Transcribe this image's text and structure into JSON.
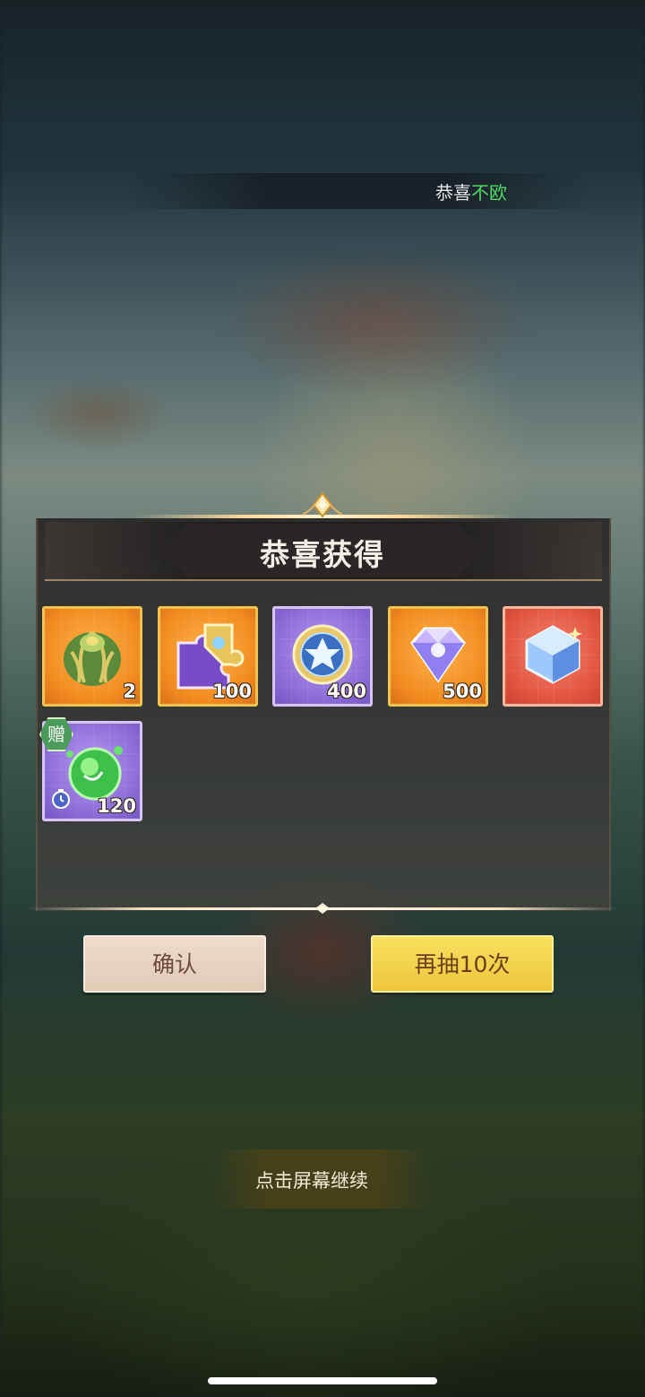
{
  "notification": {
    "prefix": "恭喜",
    "highlight": "不欧"
  },
  "panel": {
    "title": "恭喜获得"
  },
  "rewards": [
    {
      "icon": "leaf-bundle-icon",
      "rarity": "orange",
      "count": "2"
    },
    {
      "icon": "puzzle-piece-icon",
      "rarity": "orange",
      "count": "100"
    },
    {
      "icon": "star-coin-icon",
      "rarity": "purple",
      "count": "400"
    },
    {
      "icon": "diamond-gem-icon",
      "rarity": "orange",
      "count": "500"
    },
    {
      "icon": "crystal-cube-icon",
      "rarity": "red",
      "count": ""
    },
    {
      "icon": "green-slime-orb-icon",
      "rarity": "purple",
      "count": "120",
      "badge": "赠",
      "timed": true
    }
  ],
  "buttons": {
    "confirm_label": "确认",
    "draw_again_label": "再抽10次"
  },
  "continue_hint": "点击屏幕继续",
  "colors": {
    "highlight_green": "#4cd964",
    "confirm_button": "#e2c9b4",
    "draw_again_button": "#eec63c",
    "rarity_orange": "#f08a1e",
    "rarity_purple": "#8a6ad6",
    "rarity_red": "#e0533f"
  }
}
